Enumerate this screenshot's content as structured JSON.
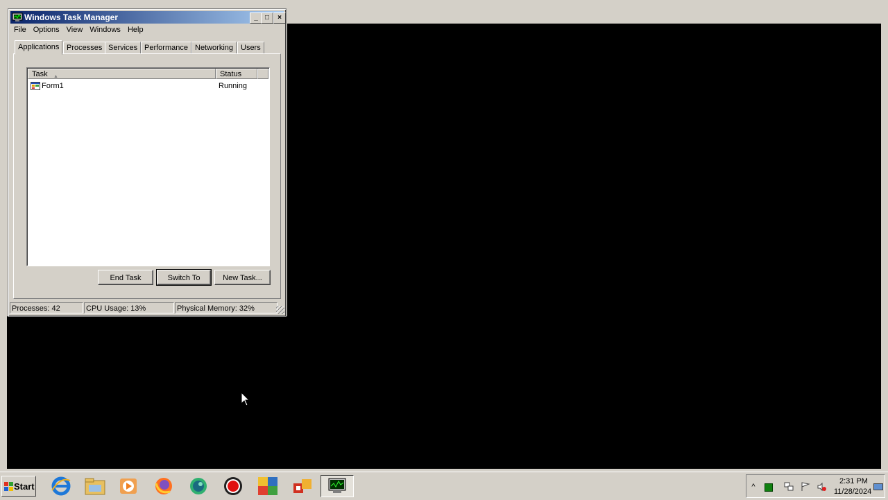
{
  "window": {
    "title": "Windows Task Manager",
    "controls": {
      "minimize": "_",
      "maximize": "□",
      "close": "×"
    }
  },
  "menu": [
    "File",
    "Options",
    "View",
    "Windows",
    "Help"
  ],
  "tabs": [
    "Applications",
    "Processes",
    "Services",
    "Performance",
    "Networking",
    "Users"
  ],
  "active_tab": "Applications",
  "table": {
    "columns": [
      "Task",
      "Status"
    ],
    "sort_indicator": "▲",
    "rows": [
      {
        "task": "Form1",
        "status": "Running"
      }
    ]
  },
  "buttons": {
    "end_task": "End Task",
    "switch_to": "Switch To",
    "new_task": "New Task..."
  },
  "statusbar": {
    "processes": "Processes: 42",
    "cpu": "CPU Usage: 13%",
    "memory": "Physical Memory: 32%"
  },
  "taskbar": {
    "start_label": "Start",
    "pinned_icons": [
      "internet-explorer-icon",
      "file-explorer-icon",
      "media-player-icon",
      "firefox-icon",
      "chat-app-icon",
      "record-icon",
      "avg-icon",
      "office-app-icon",
      "task-manager-icon"
    ],
    "tray": {
      "time": "2:31 PM",
      "date": "11/28/2024",
      "overflow": "^"
    }
  },
  "colors": {
    "title_start": "#0a246a",
    "title_end": "#a6caf0",
    "face": "#d4d0c8"
  }
}
